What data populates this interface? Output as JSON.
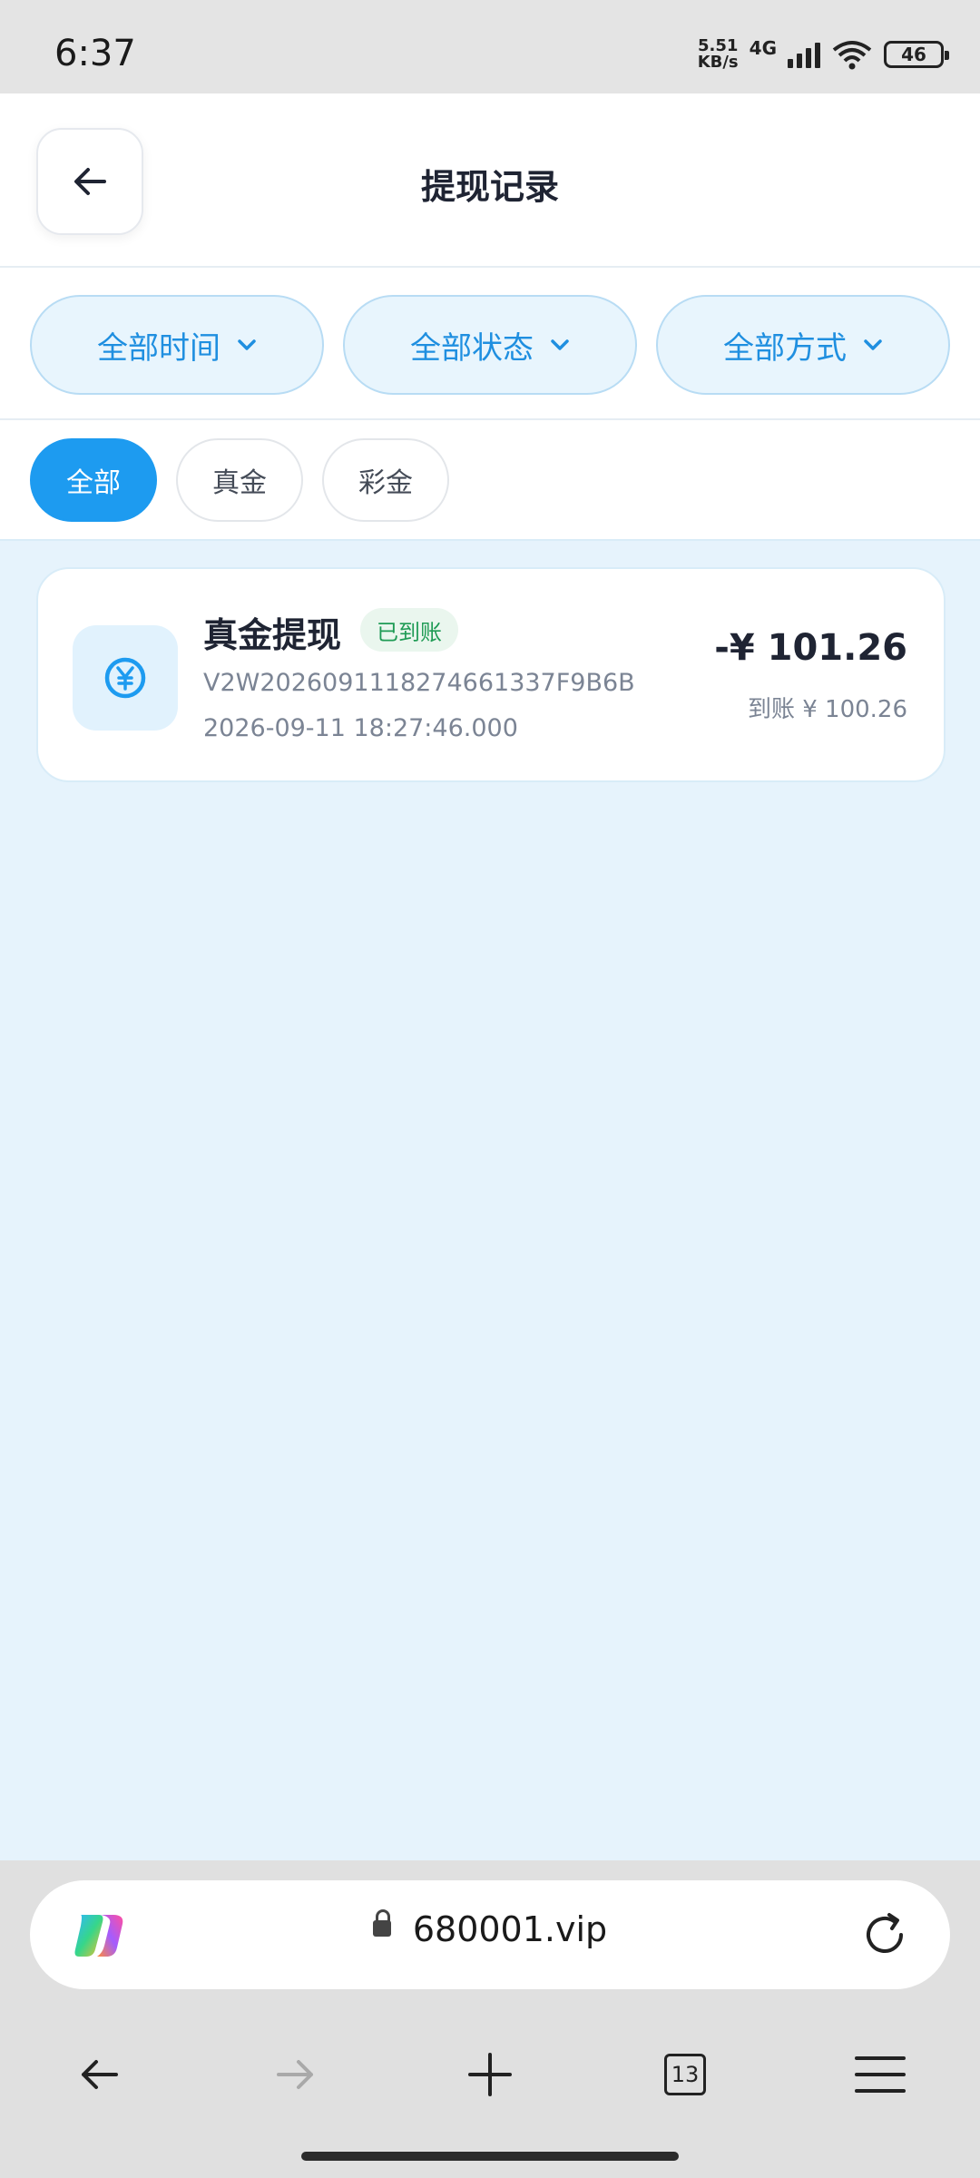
{
  "status_bar": {
    "time": "6:37",
    "net_speed_value": "5.51",
    "net_speed_unit": "KB/s",
    "network_type": "4G",
    "battery": "46"
  },
  "header": {
    "title": "提现记录"
  },
  "filters": [
    {
      "label": "全部时间"
    },
    {
      "label": "全部状态"
    },
    {
      "label": "全部方式"
    }
  ],
  "tabs": [
    {
      "label": "全部",
      "active": true
    },
    {
      "label": "真金",
      "active": false
    },
    {
      "label": "彩金",
      "active": false
    }
  ],
  "records": [
    {
      "title": "真金提现",
      "status": "已到账",
      "order_id": "V2W2026091118274661337F9B6B",
      "time": "2026-09-11 18:27:46.000",
      "amount": "-¥ 101.26",
      "received": "到账 ¥ 100.26"
    }
  ],
  "browser": {
    "url": "680001.vip",
    "tab_count": "13"
  },
  "colors": {
    "accent": "#1d9bf0",
    "page_bg": "#e6f3fc",
    "success": "#1f9b55"
  }
}
